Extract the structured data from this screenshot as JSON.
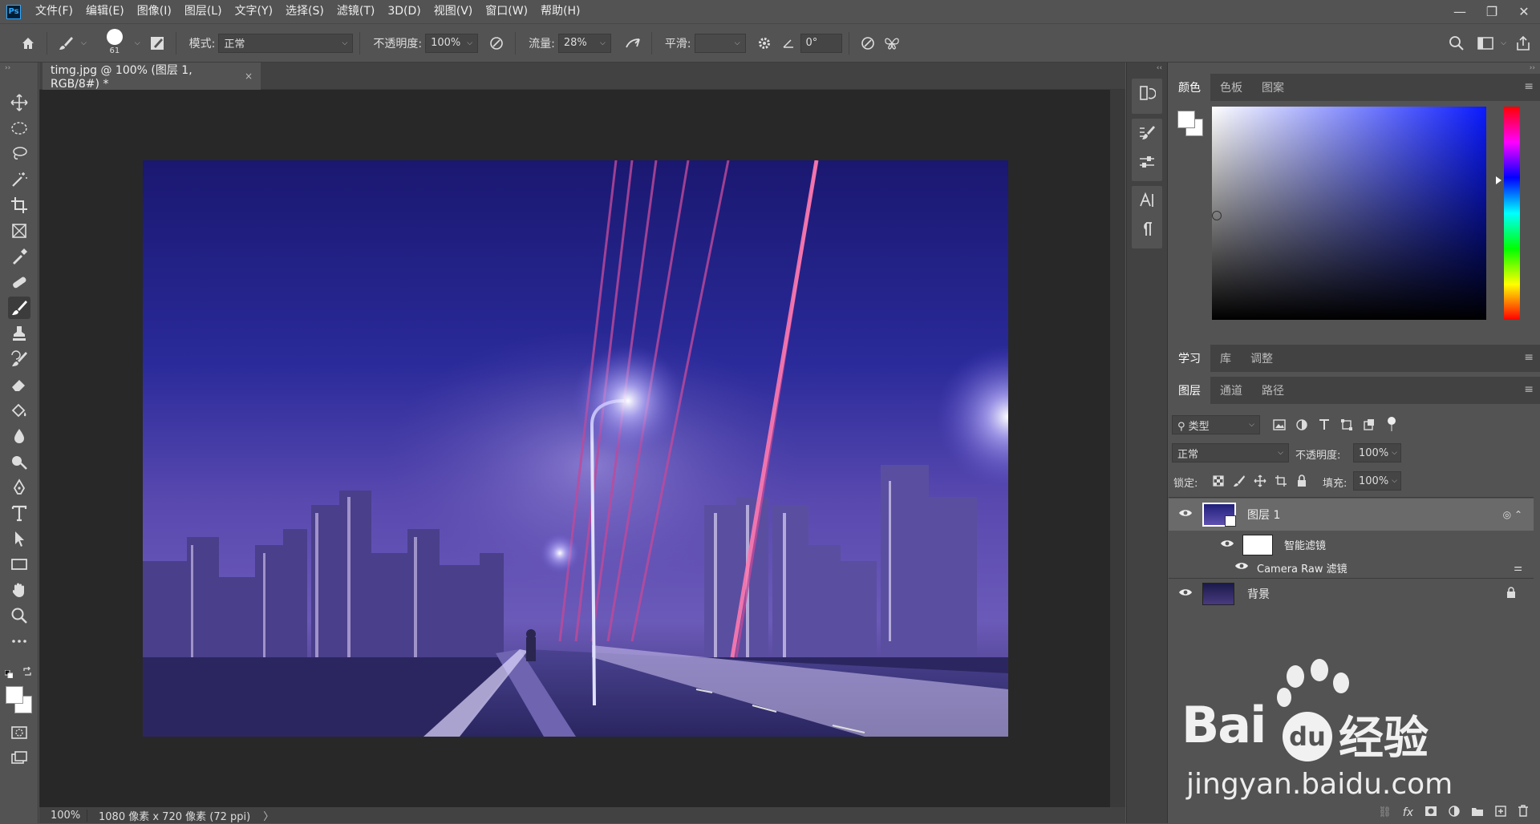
{
  "menu": {
    "items": [
      "文件(F)",
      "编辑(E)",
      "图像(I)",
      "图层(L)",
      "文字(Y)",
      "选择(S)",
      "滤镜(T)",
      "3D(D)",
      "视图(V)",
      "窗口(W)",
      "帮助(H)"
    ],
    "logo": "Ps"
  },
  "options": {
    "brush_size": "61",
    "mode_label": "模式:",
    "mode_value": "正常",
    "opacity_label": "不透明度:",
    "opacity_value": "100%",
    "flow_label": "流量:",
    "flow_value": "28%",
    "smooth_label": "平滑:",
    "angle_value": "0°"
  },
  "document": {
    "tab_title": "timg.jpg @ 100% (图层 1, RGB/8#) *",
    "close": "×",
    "zoom": "100%",
    "info": "1080 像素 x 720 像素 (72 ppi)",
    "info_arrow": "〉"
  },
  "color_panel": {
    "tabs": [
      "颜色",
      "色板",
      "图案"
    ]
  },
  "learn_panel": {
    "tabs": [
      "学习",
      "库",
      "调整"
    ]
  },
  "layers_panel": {
    "tabs": [
      "图层",
      "通道",
      "路径"
    ],
    "filter_label": "类型",
    "blend_mode": "正常",
    "opacity_label": "不透明度:",
    "opacity_value": "100%",
    "lock_label": "锁定:",
    "fill_label": "填充:",
    "fill_value": "100%",
    "layers": [
      {
        "name": "图层 1"
      },
      {
        "name": "智能滤镜"
      },
      {
        "name": "Camera Raw 滤镜"
      },
      {
        "name": "背景"
      }
    ]
  },
  "watermark": {
    "text_bai": "Bai",
    "text_du": "du",
    "text_jingyan": "经验",
    "url": "jingyan.baidu.com"
  },
  "colors": {
    "ui_bg": "#535353",
    "dark": "#424242",
    "canvas": "#282828",
    "hue_top": "#ff0000"
  }
}
